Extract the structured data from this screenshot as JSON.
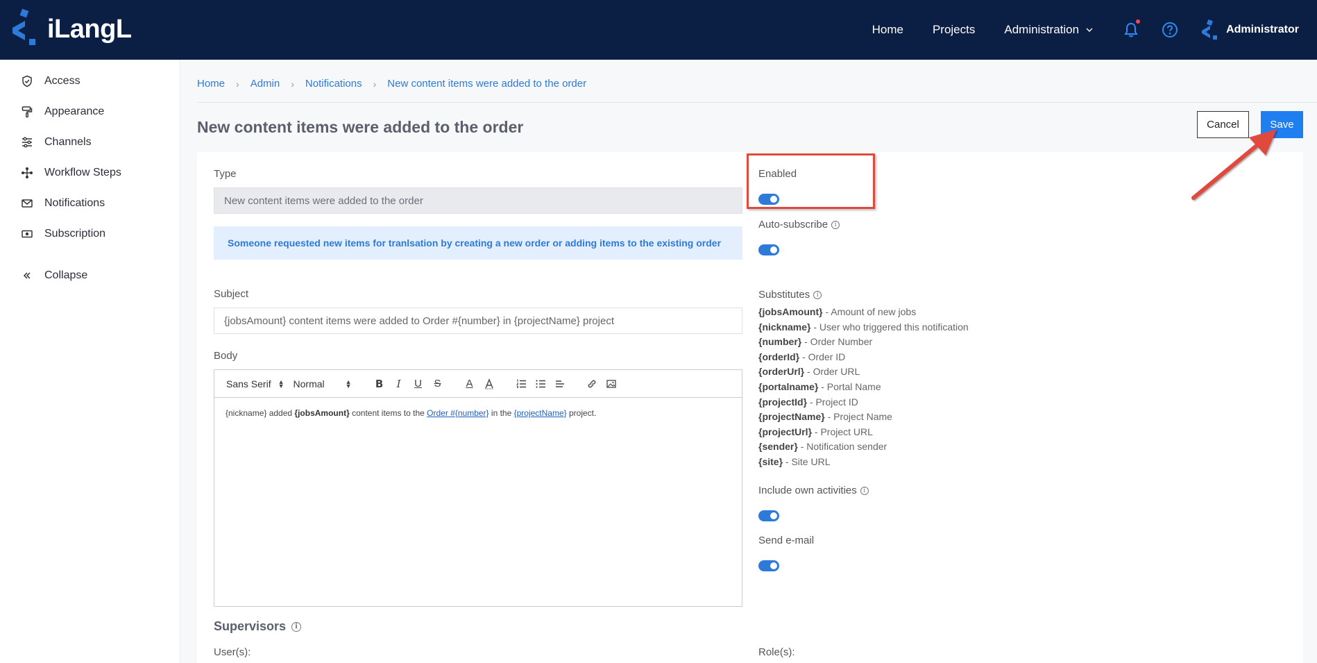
{
  "header": {
    "logo_text": "iLangL",
    "nav": {
      "home": "Home",
      "projects": "Projects",
      "administration": "Administration"
    },
    "user_name": "Administrator"
  },
  "sidebar": {
    "items": [
      {
        "label": "Access",
        "icon": "shield-icon"
      },
      {
        "label": "Appearance",
        "icon": "paint-roller-icon"
      },
      {
        "label": "Channels",
        "icon": "channels-icon"
      },
      {
        "label": "Workflow Steps",
        "icon": "workflow-icon"
      },
      {
        "label": "Notifications",
        "icon": "envelope-icon"
      },
      {
        "label": "Subscription",
        "icon": "subscription-icon"
      }
    ],
    "collapse": "Collapse"
  },
  "breadcrumb": [
    "Home",
    "Admin",
    "Notifications",
    "New content items were added to the order"
  ],
  "page": {
    "title": "New content items were added to the order",
    "cancel": "Cancel",
    "save": "Save"
  },
  "form": {
    "type_label": "Type",
    "type_value": "New content items were added to the order",
    "info": "Someone requested new items for tranlsation by creating a new order or adding items to the existing order",
    "subject_label": "Subject",
    "subject_value": "{jobsAmount} content items were added to Order #{number} in {projectName} project",
    "body_label": "Body",
    "toolbar": {
      "font": "Sans Serif",
      "size": "Normal"
    },
    "body": {
      "p1": "{nickname} added ",
      "p2": "{jobsAmount}",
      "p3": " content items to the ",
      "p4": "Order #{number}",
      "p5": " in the ",
      "p6": "{projectName}",
      "p7": " project."
    },
    "enabled_label": "Enabled",
    "enabled": true,
    "autosubscribe_label": "Auto-subscribe",
    "autosubscribe": true,
    "substitutes_label": "Substitutes",
    "substitutes": [
      {
        "key": "{jobsAmount}",
        "desc": " - Amount of new jobs"
      },
      {
        "key": "{nickname}",
        "desc": " - User who triggered this notification"
      },
      {
        "key": "{number}",
        "desc": " - Order Number"
      },
      {
        "key": "{orderId}",
        "desc": " - Order ID"
      },
      {
        "key": "{orderUrl}",
        "desc": " - Order URL"
      },
      {
        "key": "{portalname}",
        "desc": " - Portal Name"
      },
      {
        "key": "{projectId}",
        "desc": " - Project ID"
      },
      {
        "key": "{projectName}",
        "desc": " - Project Name"
      },
      {
        "key": "{projectUrl}",
        "desc": " - Project URL"
      },
      {
        "key": "{sender}",
        "desc": " - Notification sender"
      },
      {
        "key": "{site}",
        "desc": " - Site URL"
      }
    ],
    "own_activities_label": "Include own activities",
    "own_activities": true,
    "send_email_label": "Send e-mail",
    "send_email": true,
    "supervisors_title": "Supervisors",
    "users_label": "User(s):",
    "roles_label": "Role(s):"
  },
  "colors": {
    "header_bg": "#0b1e44",
    "accent": "#1f7ef0",
    "highlight": "#e04a3d"
  }
}
